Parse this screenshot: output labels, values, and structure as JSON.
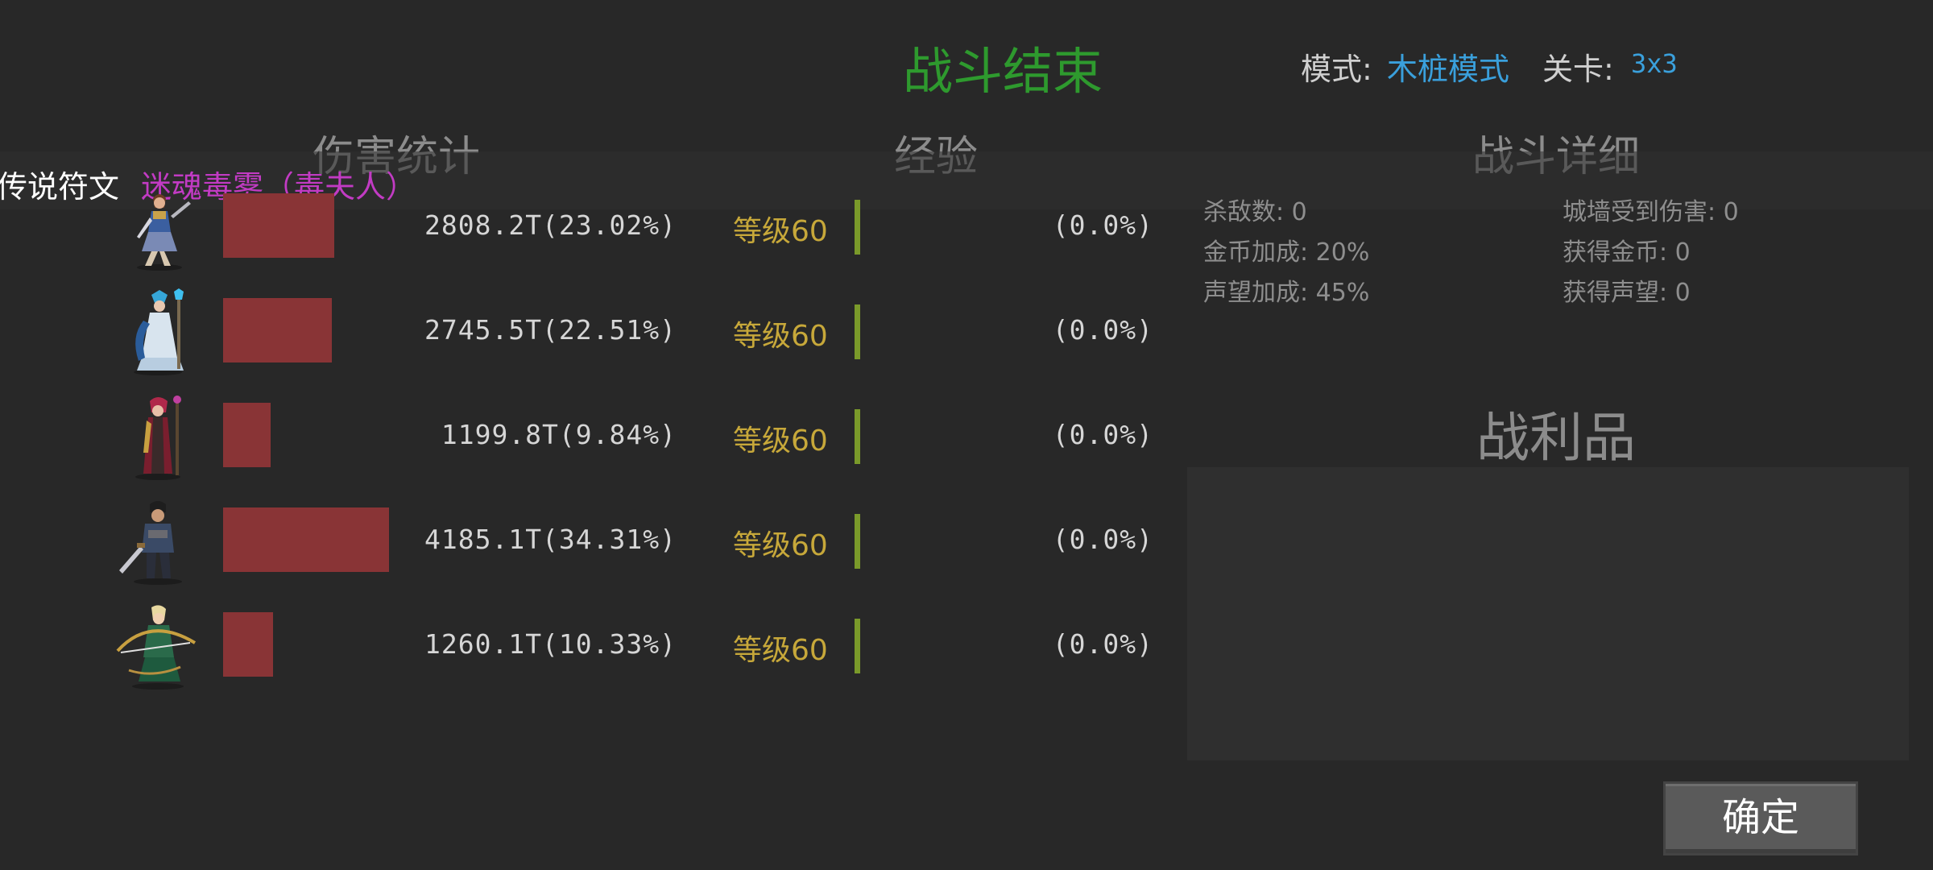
{
  "header": {
    "title": "战斗结束",
    "mode_label": "模式:",
    "mode_value": "木桩模式",
    "stage_label": "关卡:",
    "stage_value": "3x3"
  },
  "sections": {
    "damage": "伤害统计",
    "experience": "经验",
    "details": "战斗详细",
    "loot": "战利品"
  },
  "rune": {
    "label": "传说符文",
    "name": "迷魂毒雾（毒夫人）"
  },
  "heroes": [
    {
      "damage_text": "2808.2T(23.02%)",
      "damage_share": 0.2302,
      "level_text": "等级60",
      "exp_text": "(0.0%)",
      "portrait_icon": "female-warrior-portrait"
    },
    {
      "damage_text": "2745.5T(22.51%)",
      "damage_share": 0.2251,
      "level_text": "等级60",
      "exp_text": "(0.0%)",
      "portrait_icon": "ice-mage-portrait"
    },
    {
      "damage_text": "1199.8T(9.84%)",
      "damage_share": 0.0984,
      "level_text": "等级60",
      "exp_text": "(0.0%)",
      "portrait_icon": "poison-sorceress-portrait"
    },
    {
      "damage_text": "4185.1T(34.31%)",
      "damage_share": 0.3431,
      "level_text": "等级60",
      "exp_text": "(0.0%)",
      "portrait_icon": "swordsman-portrait"
    },
    {
      "damage_text": "1260.1T(10.33%)",
      "damage_share": 0.1033,
      "level_text": "等级60",
      "exp_text": "(0.0%)",
      "portrait_icon": "elf-archer-portrait"
    }
  ],
  "details": {
    "kills": "杀敌数: 0",
    "wall_damage": "城墙受到伤害: 0",
    "gold_bonus": "金币加成: 20%",
    "gold_gained": "获得金币: 0",
    "fame_bonus": "声望加成: 45%",
    "fame_gained": "获得声望: 0"
  },
  "confirm_label": "确定",
  "colors": {
    "background": "#282828",
    "title": "#2e9a2e",
    "accent_blue": "#3aa0dc",
    "damage_bar": "#893436",
    "level": "#c7a83a",
    "exp_bar": "#7a9a2a",
    "rune_name": "#c23bc4"
  }
}
